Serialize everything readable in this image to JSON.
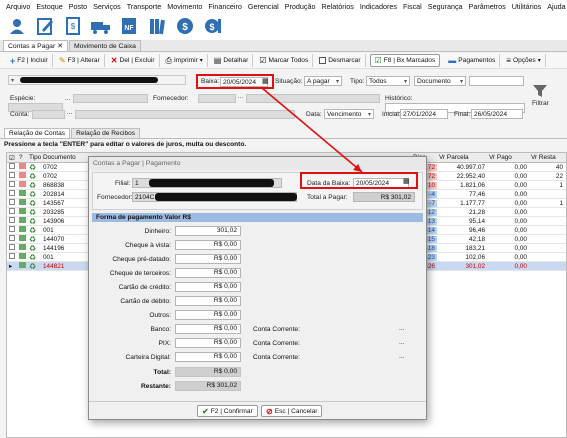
{
  "menu": [
    "Arquivo",
    "Estoque",
    "Posto",
    "Serviços",
    "Transporte",
    "Movimento",
    "Financeiro",
    "Gerencial",
    "Produção",
    "Relatórios",
    "Indicadores",
    "Fiscal",
    "Segurança",
    "Parâmetros",
    "Utilitários",
    "Ajuda"
  ],
  "iconbar": [
    "user-icon",
    "edit-icon",
    "invoice-icon",
    "truck-icon",
    "document-nf-icon",
    "books-icon",
    "money-icon",
    "money-exit-icon"
  ],
  "doc_tabs": [
    {
      "label": "Contas a Pagar",
      "close": "✕"
    },
    {
      "label": "Movimento de Caixa"
    }
  ],
  "toolbar": {
    "incluir": "F2 | Incluir",
    "alterar": "F3 | Alterar",
    "excluir": "Del | Excluir",
    "imprimir": "Imprimir",
    "detalhar": "Detalhar",
    "marcar": "Marcar Todos",
    "desmarcar": "Desmarcar",
    "bx_marcados": "F8 | Bx Marcados",
    "pagamentos": "Pagamentos",
    "opcoes": "Opções"
  },
  "filters": {
    "baixa_label": "Baixa:",
    "baixa_value": "20/05/2024",
    "situacao_label": "Situação:",
    "situacao_value": "A pagar",
    "tipo_label": "Tipo:",
    "tipo_value": "Todos",
    "documento_value": "Documento",
    "especie_label": "Espécie:",
    "fornecedor_label": "Fornecedor:",
    "historico_label": "Histórico:",
    "conta_label": "Conta:",
    "data_label": "Data:",
    "data_value": "Vencimento",
    "inicial_label": "Inicial:",
    "inicial_value": "27/01/2024",
    "final_label": "Final:",
    "final_value": "26/05/2024",
    "filtrar": "Filtrar",
    "dots": "..."
  },
  "sub_tabs": [
    "Relação de Contas",
    "Relação de Recibos"
  ],
  "hint": "Pressione a tecla \"ENTER\" para editar o valores de juros, multa ou desconto.",
  "grid": {
    "headers": {
      "check": "☑",
      "q": "?",
      "tipo": "Tipo",
      "documento": "Documento",
      "dias": "Dias",
      "vr_parcela": "Vr Parcela",
      "vr_pago": "Vr Pago",
      "vr_restante": "Vr Resta"
    },
    "rows": [
      {
        "doc": "0702",
        "dias": "72",
        "parcela": "40.997,07",
        "pago": "0,00",
        "rest": "40",
        "color": "#e88"
      },
      {
        "doc": "0702",
        "dias": "72",
        "parcela": "22.952,40",
        "pago": "0,00",
        "rest": "22",
        "color": "#e88"
      },
      {
        "doc": "868838",
        "dias": "10",
        "parcela": "1.821,06",
        "pago": "0,00",
        "rest": "1",
        "color": "#e88"
      },
      {
        "doc": "202814",
        "dias": "-4",
        "parcela": "77,46",
        "pago": "0,00",
        "rest": "",
        "color": "#6a6"
      },
      {
        "doc": "143567",
        "dias": "-7",
        "parcela": "1.177,77",
        "pago": "0,00",
        "rest": "1",
        "color": "#6a6"
      },
      {
        "doc": "203285",
        "dias": "-12",
        "parcela": "21,28",
        "pago": "0,00",
        "rest": "",
        "color": "#6a6"
      },
      {
        "doc": "143906",
        "dias": "-13",
        "parcela": "95,14",
        "pago": "0,00",
        "rest": "",
        "color": "#6a6"
      },
      {
        "doc": "001",
        "dias": "-14",
        "parcela": "96,46",
        "pago": "0,00",
        "rest": "",
        "color": "#6a6"
      },
      {
        "doc": "144070",
        "dias": "-15",
        "parcela": "42,18",
        "pago": "0,00",
        "rest": "",
        "color": "#6a6"
      },
      {
        "doc": "144196",
        "dias": "-18",
        "parcela": "183,21",
        "pago": "0,00",
        "rest": "",
        "color": "#6a6"
      },
      {
        "doc": "001",
        "dias": "-23",
        "parcela": "102,06",
        "pago": "0,00",
        "rest": "",
        "color": "#6a6"
      },
      {
        "doc": "144821",
        "dias": "-26",
        "parcela": "301,02",
        "pago": "0,00",
        "rest": "",
        "color": "#6a6",
        "selected": true
      }
    ]
  },
  "dialog": {
    "title": "Contas a Pagar | Pagamento",
    "filial_label": "Filial:",
    "filial_value": "1",
    "fornecedor_label": "Fornecedor:",
    "fornecedor_value": "2104C",
    "data_baixa_label": "Data da Baixa:",
    "data_baixa_value": "20/05/2024",
    "total_label": "Total a Pagar:",
    "total_value": "R$ 301,02",
    "section_title": "Forma de pagamento  Valor R$",
    "payments": [
      {
        "label": "Dinheiro:",
        "value": "301,02",
        "cc": false
      },
      {
        "label": "Cheque à vista:",
        "value": "R$ 0,00",
        "cc": false
      },
      {
        "label": "Cheque pré-datado:",
        "value": "R$ 0,00",
        "cc": false
      },
      {
        "label": "Cheque de terceiros:",
        "value": "R$ 0,00",
        "cc": false
      },
      {
        "label": "Cartão de crédito:",
        "value": "R$ 0,00",
        "cc": false
      },
      {
        "label": "Cartão de débito:",
        "value": "R$ 0,00",
        "cc": false
      },
      {
        "label": "Outros:",
        "value": "R$ 0,00",
        "cc": false
      },
      {
        "label": "Banco:",
        "value": "R$ 0,00",
        "cc": true
      },
      {
        "label": "PIX:",
        "value": "R$ 0,00",
        "cc": true
      },
      {
        "label": "Carteira Digital:",
        "value": "R$ 0,00",
        "cc": true
      }
    ],
    "conta_corrente_label": "Conta Corrente:",
    "total_row_label": "Total:",
    "total_row_value": "R$ 0,00",
    "restante_label": "Restante:",
    "restante_value": "R$ 301,02",
    "confirm": "F2 | Confirmar",
    "cancel": "Esc | Cancelar"
  },
  "colors": {
    "annotation": "#e01010",
    "dialog_header": "#9dbbe0",
    "selected_row": "#c9d9f2"
  }
}
